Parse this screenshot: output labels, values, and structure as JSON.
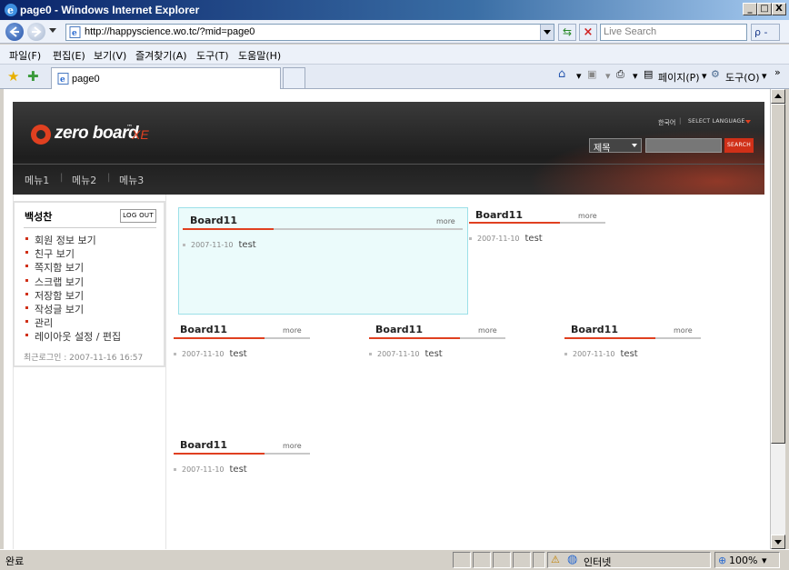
{
  "window": {
    "title": "page0 - Windows Internet Explorer",
    "minimize_label": "_",
    "maximize_label": "□",
    "close_label": "X"
  },
  "address_bar": {
    "url": "http://happyscience.wo.tc/?mid=page0",
    "search_placeholder": "Live Search",
    "search_button_label": "ρ -"
  },
  "menu": {
    "items": [
      "파일(F)",
      "편집(E)",
      "보기(V)",
      "즐겨찾기(A)",
      "도구(T)",
      "도움말(H)"
    ]
  },
  "tabs": {
    "active_title": "page0"
  },
  "command_bar": {
    "page_label": "페이지(P)",
    "tools_label": "도구(O)",
    "more_label": "»"
  },
  "site": {
    "logo_text": "zero board",
    "logo_tm": "™",
    "logo_xe": "XE",
    "language": "한국어",
    "language_sep": "|",
    "select_language": "SELECT LANGUAGE",
    "search_option": "제목",
    "search_button": "SEARCH",
    "nav": [
      "메뉴1",
      "메뉴2",
      "메뉴3"
    ]
  },
  "login": {
    "user_name": "백성찬",
    "logout_label": "LOG OUT",
    "links": [
      "회원 정보 보기",
      "친구 보기",
      "쪽지함 보기",
      "스크랩 보기",
      "저장함 보기",
      "작성글 보기",
      "관리",
      "레이아웃 설정 / 편집"
    ],
    "last_login": "최근로그인 : 2007-11-16 16:57"
  },
  "boards": [
    {
      "title": "Board11",
      "more": "more",
      "date": "2007-11-10",
      "post": "test"
    },
    {
      "title": "Board11",
      "more": "more",
      "date": "2007-11-10",
      "post": "test"
    },
    {
      "title": "Board11",
      "more": "more",
      "date": "2007-11-10",
      "post": "test"
    },
    {
      "title": "Board11",
      "more": "more",
      "date": "2007-11-10",
      "post": "test"
    },
    {
      "title": "Board11",
      "more": "more",
      "date": "2007-11-10",
      "post": "test"
    },
    {
      "title": "Board11",
      "more": "more",
      "date": "2007-11-10",
      "post": "test"
    }
  ],
  "status": {
    "text": "완료",
    "zone": "인터넷",
    "zoom": "100%"
  },
  "colors": {
    "accent_red": "#e04020",
    "highlight_bg": "#ebfbfb",
    "header_dark": "#2a2a2a"
  }
}
